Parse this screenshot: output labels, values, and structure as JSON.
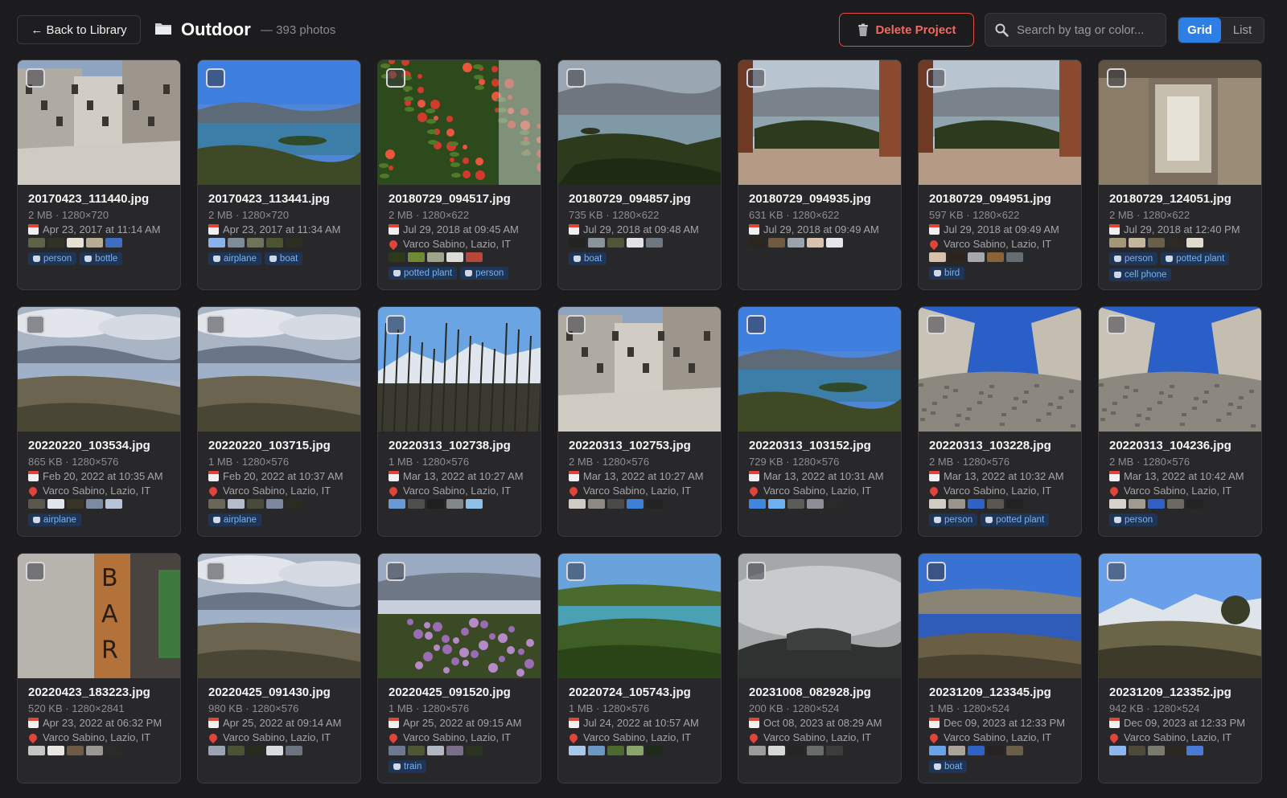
{
  "header": {
    "back_label": "← Back to Library",
    "project_title": "Outdoor",
    "photo_count": "— 393 photos",
    "delete_label": "Delete Project",
    "search_placeholder": "Search by tag or color...",
    "view_grid": "Grid",
    "view_list": "List",
    "active_view": "Grid"
  },
  "photos": [
    {
      "filename": "20170423_111440.jpg",
      "meta": "2 MB · 1280×720",
      "date": "Apr 23, 2017 at 11:14 AM",
      "location": "",
      "swatches": [
        "#5d6345",
        "#2f3325",
        "#e6e1d2",
        "#b8ad93",
        "#3e6ec0"
      ],
      "tags": [
        "person",
        "bottle"
      ],
      "scene": "village"
    },
    {
      "filename": "20170423_113441.jpg",
      "meta": "2 MB · 1280×720",
      "date": "Apr 23, 2017 at 11:34 AM",
      "location": "",
      "swatches": [
        "#8ab2e8",
        "#7d8c98",
        "#6f7358",
        "#4d5432",
        "#2a3020"
      ],
      "tags": [
        "airplane",
        "boat"
      ],
      "scene": "lake_blue"
    },
    {
      "filename": "20180729_094517.jpg",
      "meta": "2 MB · 1280×622",
      "date": "Jul 29, 2018 at 09:45 AM",
      "location": "Varco Sabino, Lazio, IT",
      "swatches": [
        "#2c3a1a",
        "#6f8a36",
        "#9ea58b",
        "#dcdcd6",
        "#b9463a"
      ],
      "tags": [
        "potted plant",
        "person"
      ],
      "scene": "flowers_red"
    },
    {
      "filename": "20180729_094857.jpg",
      "meta": "735 KB · 1280×622",
      "date": "Jul 29, 2018 at 09:48 AM",
      "location": "",
      "swatches": [
        "#232420",
        "#8a949c",
        "#51563a",
        "#e2e3e6",
        "#6f7780"
      ],
      "tags": [
        "boat"
      ],
      "scene": "lake_grey"
    },
    {
      "filename": "20180729_094935.jpg",
      "meta": "631 KB · 1280×622",
      "date": "Jul 29, 2018 at 09:49 AM",
      "location": "",
      "swatches": [
        "#2b2520",
        "#705a40",
        "#9aa3ae",
        "#d8c2ad",
        "#e4e6ea"
      ],
      "tags": [],
      "scene": "terrace"
    },
    {
      "filename": "20180729_094951.jpg",
      "meta": "597 KB · 1280×622",
      "date": "Jul 29, 2018 at 09:49 AM",
      "location": "Varco Sabino, Lazio, IT",
      "swatches": [
        "#d6c2a8",
        "#2e241d",
        "#a5a8ad",
        "#8a6434",
        "#666c74"
      ],
      "tags": [
        "bird"
      ],
      "scene": "terrace"
    },
    {
      "filename": "20180729_124051.jpg",
      "meta": "2 MB · 1280×622",
      "date": "Jul 29, 2018 at 12:40 PM",
      "location": "",
      "swatches": [
        "#a49678",
        "#c4b89a",
        "#6a6048",
        "#2e2a23",
        "#e2dccc"
      ],
      "tags": [
        "person",
        "potted plant",
        "cell phone"
      ],
      "scene": "alley"
    },
    {
      "filename": "20220220_103534.jpg",
      "meta": "865 KB · 1280×576",
      "date": "Feb 20, 2022 at 10:35 AM",
      "location": "Varco Sabino, Lazio, IT",
      "swatches": [
        "#5c574c",
        "#e2e5ec",
        "#393525",
        "#7d8aa3",
        "#b7c3d8"
      ],
      "tags": [
        "airplane"
      ],
      "scene": "lake_cloudy"
    },
    {
      "filename": "20220220_103715.jpg",
      "meta": "1 MB · 1280×576",
      "date": "Feb 20, 2022 at 10:37 AM",
      "location": "Varco Sabino, Lazio, IT",
      "swatches": [
        "#6b6658",
        "#b5bdcc",
        "#4a4a3b",
        "#7d88a0",
        "#2a2c22"
      ],
      "tags": [
        "airplane"
      ],
      "scene": "lake_cloudy"
    },
    {
      "filename": "20220313_102738.jpg",
      "meta": "1 MB · 1280×576",
      "date": "Mar 13, 2022 at 10:27 AM",
      "location": "Varco Sabino, Lazio, IT",
      "swatches": [
        "#6a9ad6",
        "#4e4e4c",
        "#1f1f1e",
        "#848789",
        "#8fc0ea"
      ],
      "tags": [],
      "scene": "trees_bare"
    },
    {
      "filename": "20220313_102753.jpg",
      "meta": "2 MB · 1280×576",
      "date": "Mar 13, 2022 at 10:27 AM",
      "location": "Varco Sabino, Lazio, IT",
      "swatches": [
        "#cfccc6",
        "#8d8a84",
        "#4c4a46",
        "#3e7fd8",
        "#232322"
      ],
      "tags": [],
      "scene": "village"
    },
    {
      "filename": "20220313_103152.jpg",
      "meta": "729 KB · 1280×576",
      "date": "Mar 13, 2022 at 10:31 AM",
      "location": "Varco Sabino, Lazio, IT",
      "swatches": [
        "#3e86de",
        "#6fb0f0",
        "#5b5b58",
        "#8e8f96",
        "#2a2a28"
      ],
      "tags": [],
      "scene": "lake_blue"
    },
    {
      "filename": "20220313_103228.jpg",
      "meta": "2 MB · 1280×576",
      "date": "Mar 13, 2022 at 10:32 AM",
      "location": "Varco Sabino, Lazio, IT",
      "swatches": [
        "#d3ccc2",
        "#9a948c",
        "#2f62c8",
        "#5a5652",
        "#232220"
      ],
      "tags": [
        "person",
        "potted plant"
      ],
      "scene": "castle"
    },
    {
      "filename": "20220313_104236.jpg",
      "meta": "2 MB · 1280×576",
      "date": "Mar 13, 2022 at 10:42 AM",
      "location": "Varco Sabino, Lazio, IT",
      "swatches": [
        "#d8d3ca",
        "#a09a90",
        "#2e60c6",
        "#6c6862",
        "#252422"
      ],
      "tags": [
        "person"
      ],
      "scene": "castle"
    },
    {
      "filename": "20220423_183223.jpg",
      "meta": "520 KB · 1280×2841",
      "date": "Apr 23, 2022 at 06:32 PM",
      "location": "Varco Sabino, Lazio, IT",
      "swatches": [
        "#c7c5c1",
        "#e8e6e2",
        "#6e5a45",
        "#9a9894",
        "#2c2a27"
      ],
      "tags": [],
      "scene": "bar"
    },
    {
      "filename": "20220425_091430.jpg",
      "meta": "980 KB · 1280×576",
      "date": "Apr 25, 2022 at 09:14 AM",
      "location": "Varco Sabino, Lazio, IT",
      "swatches": [
        "#9aa4b2",
        "#4a5432",
        "#262d1c",
        "#d8dbe0",
        "#6b7480"
      ],
      "tags": [],
      "scene": "lake_cloudy"
    },
    {
      "filename": "20220425_091520.jpg",
      "meta": "1 MB · 1280×576",
      "date": "Apr 25, 2022 at 09:15 AM",
      "location": "Varco Sabino, Lazio, IT",
      "swatches": [
        "#6e7890",
        "#4e5634",
        "#b2b7c4",
        "#7a6e88",
        "#2a3420"
      ],
      "tags": [
        "train"
      ],
      "scene": "flowers_purple"
    },
    {
      "filename": "20220724_105743.jpg",
      "meta": "1 MB · 1280×576",
      "date": "Jul 24, 2022 at 10:57 AM",
      "location": "Varco Sabino, Lazio, IT",
      "swatches": [
        "#a8c8ea",
        "#6a98c4",
        "#4c6a30",
        "#8aa46a",
        "#1f2a18"
      ],
      "tags": [],
      "scene": "lake_turquoise"
    },
    {
      "filename": "20231008_082928.jpg",
      "meta": "200 KB · 1280×524",
      "date": "Oct 08, 2023 at 08:29 AM",
      "location": "Varco Sabino, Lazio, IT",
      "swatches": [
        "#9a9c9c",
        "#d6d8d8",
        "#242624",
        "#6a6c6a",
        "#3c3e3c"
      ],
      "tags": [],
      "scene": "fog"
    },
    {
      "filename": "20231209_123345.jpg",
      "meta": "1 MB · 1280×524",
      "date": "Dec 09, 2023 at 12:33 PM",
      "location": "Varco Sabino, Lazio, IT",
      "swatches": [
        "#6aa2ea",
        "#a8a49a",
        "#2e62c4",
        "#252422",
        "#6a6048"
      ],
      "tags": [
        "boat"
      ],
      "scene": "lake_deep"
    },
    {
      "filename": "20231209_123352.jpg",
      "meta": "942 KB · 1280×524",
      "date": "Dec 09, 2023 at 12:33 PM",
      "location": "Varco Sabino, Lazio, IT",
      "swatches": [
        "#8ab8ee",
        "#4e4a3a",
        "#7a7a6e",
        "#2a2820",
        "#4a7ad6"
      ],
      "tags": [],
      "scene": "mountains"
    }
  ]
}
